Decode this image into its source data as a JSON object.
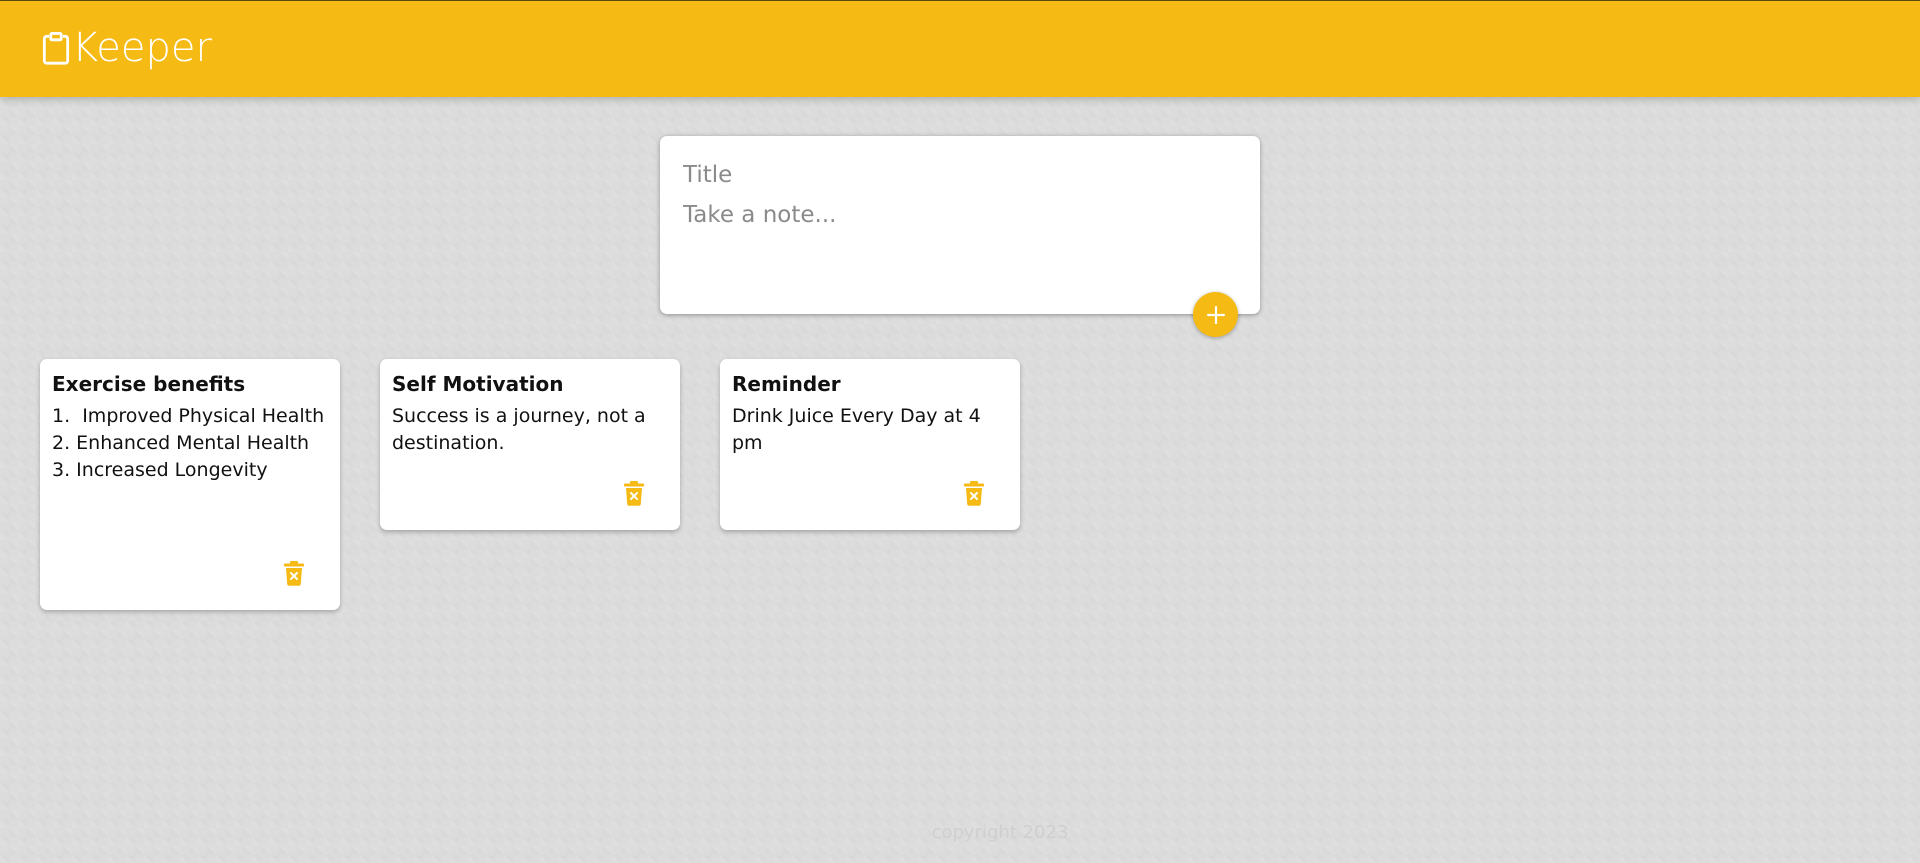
{
  "header": {
    "app_title": "Keeper",
    "logo_icon": "clipboard-icon",
    "background_color": "#f5ba13"
  },
  "create_note": {
    "title_placeholder": "Title",
    "content_placeholder": "Take a note...",
    "title_value": "",
    "content_value": "",
    "add_icon": "plus-icon",
    "accent_color": "#f5ba13"
  },
  "notes": [
    {
      "title": "Exercise benefits",
      "content": "1.  Improved Physical Health\n2. Enhanced Mental Health\n3. Increased Longevity",
      "delete_icon": "delete-forever-icon"
    },
    {
      "title": "Self Motivation",
      "content": "Success is a journey, not a destination.",
      "delete_icon": "delete-forever-icon"
    },
    {
      "title": "Reminder",
      "content": "Drink Juice Every Day at 4 pm",
      "delete_icon": "delete-forever-icon"
    }
  ],
  "footer": {
    "copyright": "copyright 2023"
  }
}
